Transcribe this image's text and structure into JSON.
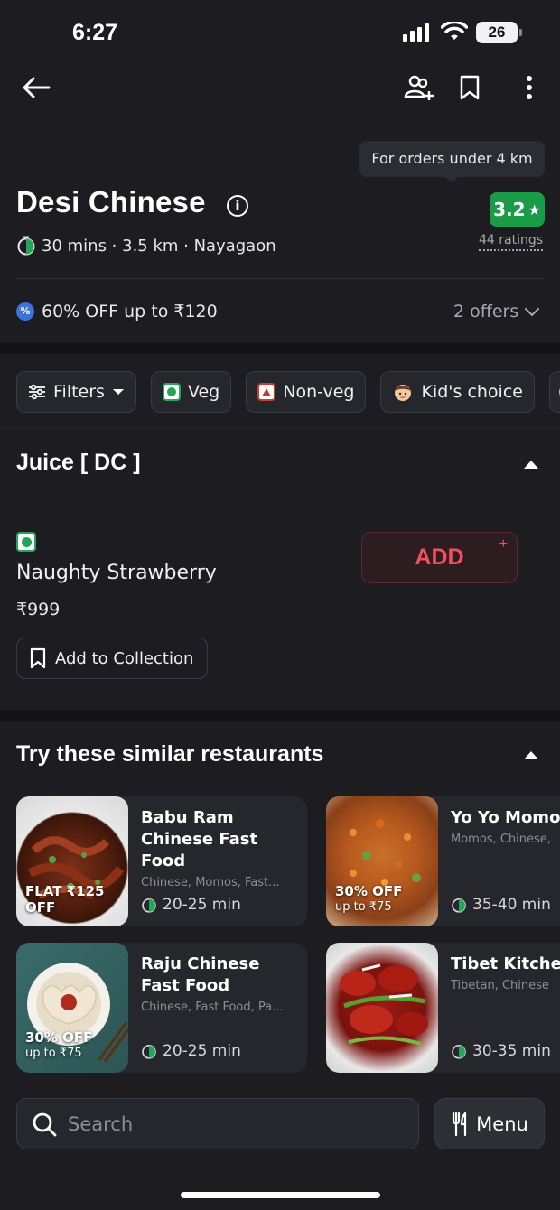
{
  "status_bar": {
    "time": "6:27",
    "battery": "26"
  },
  "header": {
    "tooltip": "For orders under 4 km",
    "restaurant_name": "Desi Chinese",
    "meta": "30 mins · 3.5 km · Nayagaon",
    "rating": "3.2",
    "ratings_count": "44 ratings",
    "offer": "60% OFF up to ₹120",
    "offers_link": "2 offers"
  },
  "filters": [
    {
      "label": "Filters"
    },
    {
      "label": "Veg"
    },
    {
      "label": "Non-veg"
    },
    {
      "label": "Kid's choice"
    }
  ],
  "menu_section": {
    "title": "Juice [ DC ]",
    "item": {
      "name": "Naughty Strawberry",
      "price": "₹999",
      "collection_label": "Add to Collection",
      "add_label": "ADD",
      "add_plus": "+"
    }
  },
  "similar": {
    "title": "Try these similar restaurants",
    "cards": [
      {
        "name": "Babu Ram Chinese Fast Food",
        "cuisine": "Chinese, Momos, Fast...",
        "time": "20-25 min",
        "offer": "FLAT ₹125 OFF",
        "offer_sub": ""
      },
      {
        "name": "Yo Yo Momos",
        "cuisine": "Momos, Chinese,",
        "time": "35-40 min",
        "offer": "30% OFF",
        "offer_sub": "up to ₹75"
      },
      {
        "name": "Raju Chinese Fast Food",
        "cuisine": "Chinese, Fast Food, Pa...",
        "time": "20-25 min",
        "offer": "30% OFF",
        "offer_sub": "up to ₹75"
      },
      {
        "name": "Tibet Kitchen",
        "cuisine": "Tibetan, Chinese",
        "time": "30-35 min",
        "offer": "",
        "offer_sub": ""
      }
    ]
  },
  "bottom": {
    "search_placeholder": "Search",
    "menu_label": "Menu"
  },
  "colors": {
    "background": "#1c1c21",
    "rating_green": "#1a9b47",
    "add_red": "#ef4f5f",
    "veg_green": "#24a55a"
  }
}
